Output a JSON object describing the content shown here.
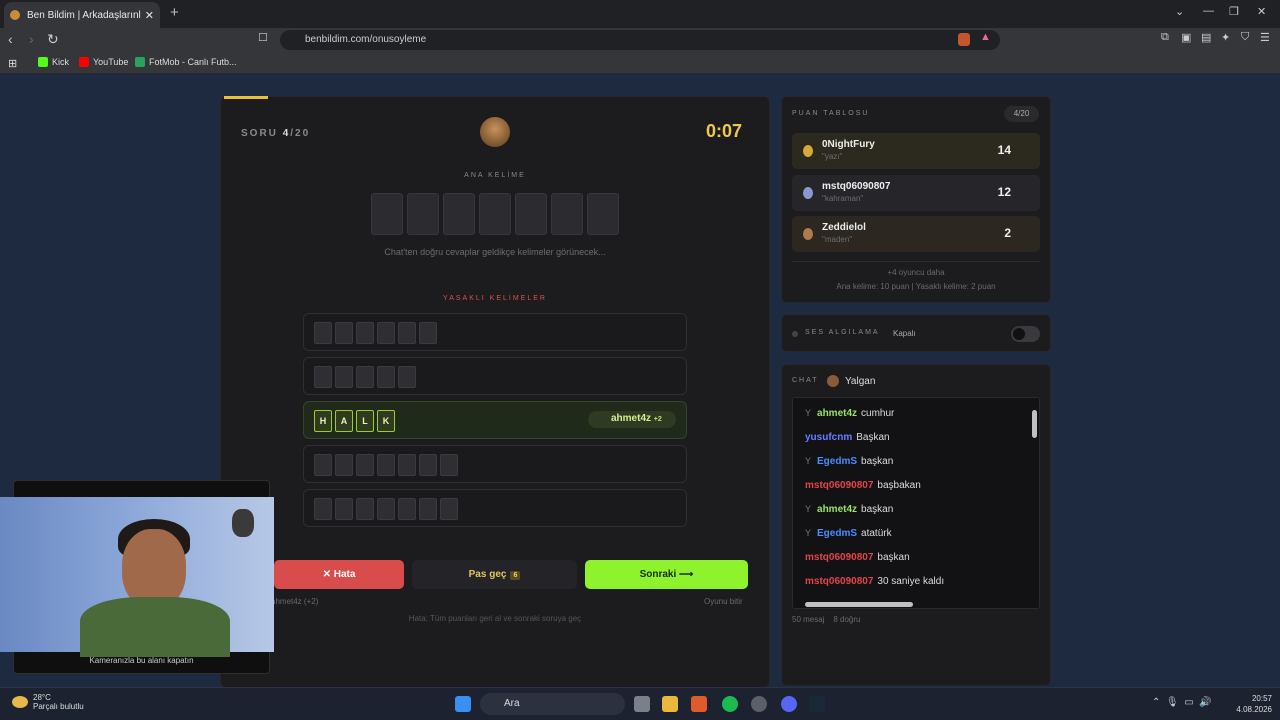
{
  "browser": {
    "tab_title": "Ben Bildim | Arkadaşlarınla Online",
    "url": "benbildim.com/onusoyleme",
    "bookmarks": [
      "Kick",
      "YouTube",
      "FotMob - Canlı Futb..."
    ]
  },
  "game": {
    "question_label": "SORU",
    "question_current": "4",
    "question_total": "/20",
    "timer": "0:07",
    "main_word_label": "ANA KELİME",
    "hint": "Chat'ten doğru cevaplar geldikçe kelimeler görünecek...",
    "forbidden_label": "YASAKLI KELİMELER",
    "revealed_letters": [
      "H",
      "A",
      "L",
      "K"
    ],
    "revealed_by": "ahmet4z",
    "revealed_bonus": "+2",
    "btn_wrong": "✕ Hata",
    "btn_skip": "Pas geç",
    "skip_count": "6",
    "btn_next": "Sonraki ⟶",
    "sub_left": "ahmet4z (+2)",
    "sub_right": "Oyunu bitir",
    "footer_note": "Hata: Tüm puanları geri al ve sonraki soruya geç",
    "progress": 0.2
  },
  "camera": {
    "caption": "Kameranızla bu alanı kapatın"
  },
  "leaderboard": {
    "title": "PUAN TABLOSU",
    "count": "4/20",
    "players": [
      {
        "name": "0NightFury",
        "word": "\"yazı\"",
        "score": "14"
      },
      {
        "name": "mstq06090807",
        "word": "\"kahraman\"",
        "score": "12"
      },
      {
        "name": "Zeddielol",
        "word": "\"maden\"",
        "score": "2"
      }
    ],
    "more": "+4 oyuncu daha",
    "rules": "Ana kelime: 10 puan | Yasaklı kelime: 2 puan"
  },
  "sound": {
    "label": "SES ALGILAMA",
    "status": "Kapalı"
  },
  "chat": {
    "label": "CHAT",
    "channel": "Yalgan",
    "messages": [
      {
        "user": "ahmet4z",
        "text": "cumhur",
        "color": "#9be36a",
        "icon": true
      },
      {
        "user": "yusufcnm",
        "text": "Başkan",
        "color": "#6b7dff",
        "icon": false
      },
      {
        "user": "EgedmS",
        "text": "başkan",
        "color": "#4a8cff",
        "icon": true
      },
      {
        "user": "mstq06090807",
        "text": "başbakan",
        "color": "#e0444a",
        "icon": false
      },
      {
        "user": "ahmet4z",
        "text": "başkan",
        "color": "#9be36a",
        "icon": true
      },
      {
        "user": "EgedmS",
        "text": "atatürk",
        "color": "#4a8cff",
        "icon": true
      },
      {
        "user": "mstq06090807",
        "text": "başkan",
        "color": "#e0444a",
        "icon": false
      },
      {
        "user": "mstq06090807",
        "text": "30 saniye kaldı",
        "color": "#e0444a",
        "icon": false
      }
    ],
    "stat_messages": "50 mesaj",
    "stat_correct": "8 doğru"
  },
  "taskbar": {
    "temp": "28°C",
    "weather": "Parçalı bulutlu",
    "search": "Ara",
    "time": "20:57",
    "date": "4.08.2026"
  }
}
